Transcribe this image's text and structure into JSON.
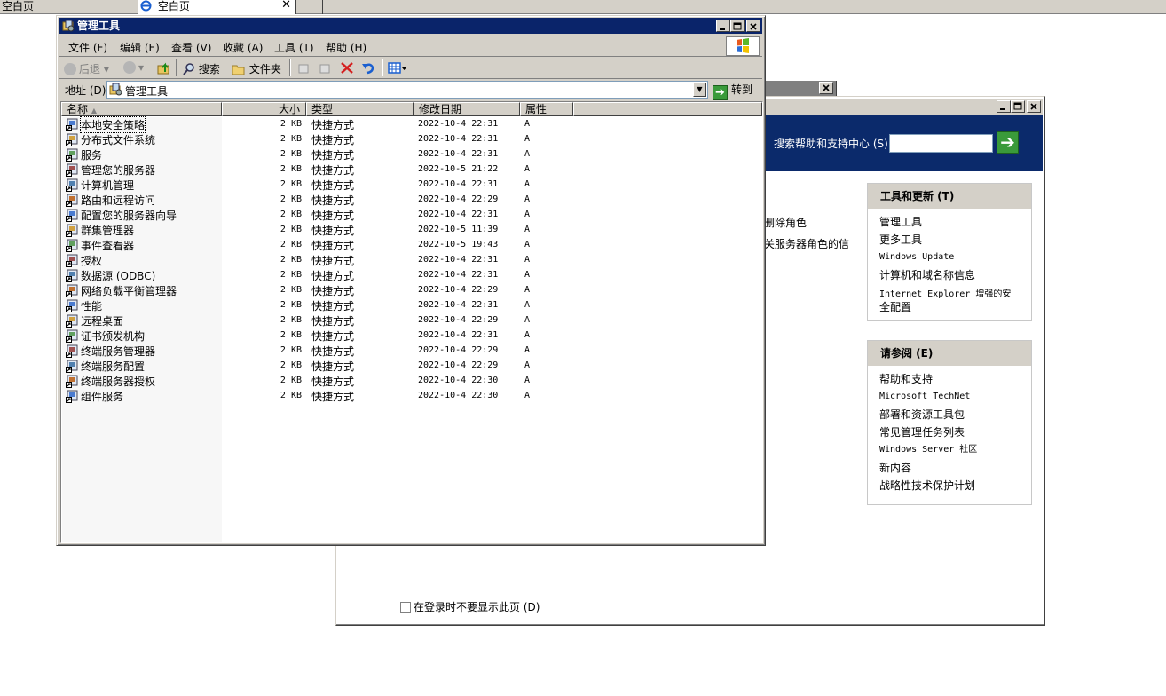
{
  "taskbar": {
    "tabs": [
      {
        "label": "空白页"
      },
      {
        "label": "空白页"
      }
    ],
    "close_glyph": "✕"
  },
  "background_window": {
    "search_label": "搜索帮助和支持中心 (S)",
    "go_glyph": "➔",
    "partial_text_1": "删除角色",
    "partial_text_2": "关服务器角色的信",
    "panel_tools": {
      "title": "工具和更新 (T)",
      "items": [
        "管理工具",
        "更多工具",
        "Windows Update",
        "计算机和域名称信息",
        "Internet Explorer 增强的安",
        "全配置"
      ]
    },
    "panel_see_also": {
      "title": "请参阅 (E)",
      "items": [
        "帮助和支持",
        "Microsoft TechNet",
        "部署和资源工具包",
        "常见管理任务列表",
        "Windows Server 社区",
        "新内容",
        "战略性技术保护计划"
      ]
    },
    "checkbox_label": "在登录时不要显示此页 (D)"
  },
  "explorer": {
    "title": "管理工具",
    "menu": [
      "文件 (F)",
      "编辑 (E)",
      "查看 (V)",
      "收藏 (A)",
      "工具 (T)",
      "帮助 (H)"
    ],
    "toolbar": {
      "back": "后退",
      "search": "搜索",
      "folders": "文件夹"
    },
    "address": {
      "label": "地址 (D)",
      "value": "管理工具",
      "go": "转到"
    },
    "columns": [
      "名称",
      "大小",
      "类型",
      "修改日期",
      "属性"
    ],
    "rows": [
      {
        "name": "本地安全策略",
        "size": "2 KB",
        "type": "快捷方式",
        "date": "2022-10-4 22:31",
        "attr": "A"
      },
      {
        "name": "分布式文件系统",
        "size": "2 KB",
        "type": "快捷方式",
        "date": "2022-10-4 22:31",
        "attr": "A"
      },
      {
        "name": "服务",
        "size": "2 KB",
        "type": "快捷方式",
        "date": "2022-10-4 22:31",
        "attr": "A"
      },
      {
        "name": "管理您的服务器",
        "size": "2 KB",
        "type": "快捷方式",
        "date": "2022-10-5 21:22",
        "attr": "A"
      },
      {
        "name": "计算机管理",
        "size": "2 KB",
        "type": "快捷方式",
        "date": "2022-10-4 22:31",
        "attr": "A"
      },
      {
        "name": "路由和远程访问",
        "size": "2 KB",
        "type": "快捷方式",
        "date": "2022-10-4 22:29",
        "attr": "A"
      },
      {
        "name": "配置您的服务器向导",
        "size": "2 KB",
        "type": "快捷方式",
        "date": "2022-10-4 22:31",
        "attr": "A"
      },
      {
        "name": "群集管理器",
        "size": "2 KB",
        "type": "快捷方式",
        "date": "2022-10-5 11:39",
        "attr": "A"
      },
      {
        "name": "事件查看器",
        "size": "2 KB",
        "type": "快捷方式",
        "date": "2022-10-5 19:43",
        "attr": "A"
      },
      {
        "name": "授权",
        "size": "2 KB",
        "type": "快捷方式",
        "date": "2022-10-4 22:31",
        "attr": "A"
      },
      {
        "name": "数据源 (ODBC)",
        "size": "2 KB",
        "type": "快捷方式",
        "date": "2022-10-4 22:31",
        "attr": "A"
      },
      {
        "name": "网络负载平衡管理器",
        "size": "2 KB",
        "type": "快捷方式",
        "date": "2022-10-4 22:29",
        "attr": "A"
      },
      {
        "name": "性能",
        "size": "2 KB",
        "type": "快捷方式",
        "date": "2022-10-4 22:31",
        "attr": "A"
      },
      {
        "name": "远程桌面",
        "size": "2 KB",
        "type": "快捷方式",
        "date": "2022-10-4 22:29",
        "attr": "A"
      },
      {
        "name": "证书颁发机构",
        "size": "2 KB",
        "type": "快捷方式",
        "date": "2022-10-4 22:31",
        "attr": "A"
      },
      {
        "name": "终端服务管理器",
        "size": "2 KB",
        "type": "快捷方式",
        "date": "2022-10-4 22:29",
        "attr": "A"
      },
      {
        "name": "终端服务配置",
        "size": "2 KB",
        "type": "快捷方式",
        "date": "2022-10-4 22:29",
        "attr": "A"
      },
      {
        "name": "终端服务器授权",
        "size": "2 KB",
        "type": "快捷方式",
        "date": "2022-10-4 22:30",
        "attr": "A"
      },
      {
        "name": "组件服务",
        "size": "2 KB",
        "type": "快捷方式",
        "date": "2022-10-4 22:30",
        "attr": "A"
      }
    ]
  },
  "colors": {
    "active_title": "#0a246a",
    "inactive_title": "#808080",
    "banner": "#0b2a6b",
    "face": "#d4d0c8"
  }
}
